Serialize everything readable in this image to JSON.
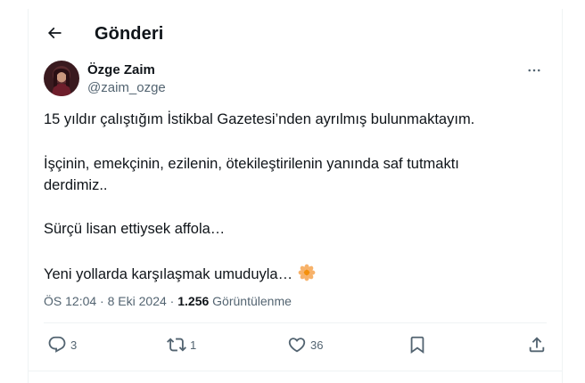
{
  "header": {
    "title": "Gönderi",
    "back_icon": "arrow-left-icon"
  },
  "author": {
    "name": "Özge Zaim",
    "handle": "@zaim_ozge"
  },
  "tweet": {
    "paragraphs": [
      "15 yıldır çalıştığım İstikbal Gazetesi’nden ayrılmış bulunmaktayım.",
      "İşçinin, emekçinin, ezilenin, ötekileştirilenin yanında saf tutmaktı derdimiz..",
      "Sürçü lisan ettiysek affola…",
      "Yeni yollarda karşılaşmak umuduyla…"
    ],
    "emoji": "flower-emoji"
  },
  "meta": {
    "time": "ÖS 12:04",
    "separator": "·",
    "date": "8 Eki 2024",
    "views_count": "1.256",
    "views_label": "Görüntülenme"
  },
  "actions": {
    "reply_count": "3",
    "retweet_count": "1",
    "like_count": "36"
  },
  "colors": {
    "text": "#0f1419",
    "secondary": "#536471",
    "divider": "#eff3f4"
  }
}
